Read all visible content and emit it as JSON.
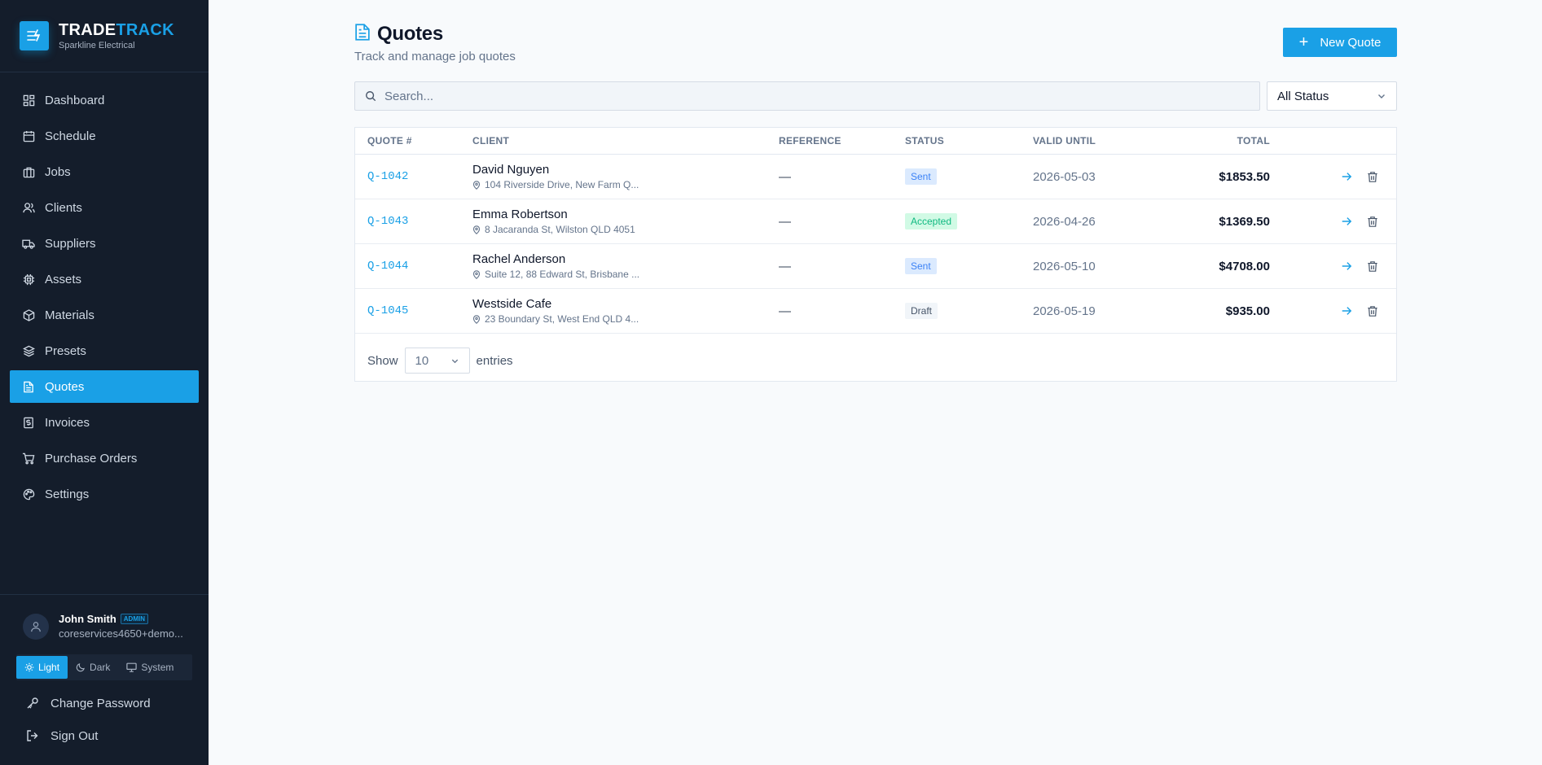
{
  "brand": {
    "name_part1": "TRADE",
    "name_part2": "TRACK",
    "company": "Sparkline Electrical",
    "logo_icon": "lightning-waves-icon"
  },
  "nav": [
    {
      "label": "Dashboard",
      "icon": "grid-icon"
    },
    {
      "label": "Schedule",
      "icon": "calendar-icon"
    },
    {
      "label": "Jobs",
      "icon": "briefcase-icon"
    },
    {
      "label": "Clients",
      "icon": "users-icon"
    },
    {
      "label": "Suppliers",
      "icon": "truck-icon"
    },
    {
      "label": "Assets",
      "icon": "chip-icon"
    },
    {
      "label": "Materials",
      "icon": "box-icon"
    },
    {
      "label": "Presets",
      "icon": "layers-icon"
    },
    {
      "label": "Quotes",
      "icon": "file-text-icon",
      "active": true
    },
    {
      "label": "Invoices",
      "icon": "dollar-file-icon"
    },
    {
      "label": "Purchase Orders",
      "icon": "cart-icon"
    },
    {
      "label": "Settings",
      "icon": "palette-icon"
    }
  ],
  "user": {
    "name": "John Smith",
    "role": "ADMIN",
    "email": "coreservices4650+demo..."
  },
  "theme": {
    "light": "Light",
    "dark": "Dark",
    "system": "System",
    "selected": "Light"
  },
  "account": {
    "change_password": "Change Password",
    "sign_out": "Sign Out"
  },
  "page": {
    "title": "Quotes",
    "subtitle": "Track and manage job quotes",
    "new_button": "New Quote"
  },
  "filters": {
    "search_placeholder": "Search...",
    "search_value": "",
    "status_selected": "All Status"
  },
  "table": {
    "columns": [
      "QUOTE #",
      "CLIENT",
      "REFERENCE",
      "STATUS",
      "VALID UNTIL",
      "TOTAL"
    ],
    "rows": [
      {
        "quote": "Q-1042",
        "client": "David Nguyen",
        "address": "104 Riverside Drive, New Farm Q...",
        "reference": "—",
        "status": "Sent",
        "valid_until": "2026-05-03",
        "total": "$1853.50"
      },
      {
        "quote": "Q-1043",
        "client": "Emma Robertson",
        "address": "8 Jacaranda St, Wilston QLD 4051",
        "reference": "—",
        "status": "Accepted",
        "valid_until": "2026-04-26",
        "total": "$1369.50"
      },
      {
        "quote": "Q-1044",
        "client": "Rachel Anderson",
        "address": "Suite 12, 88 Edward St, Brisbane ...",
        "reference": "—",
        "status": "Sent",
        "valid_until": "2026-05-10",
        "total": "$4708.00"
      },
      {
        "quote": "Q-1045",
        "client": "Westside Cafe",
        "address": "23 Boundary St, West End QLD 4...",
        "reference": "—",
        "status": "Draft",
        "valid_until": "2026-05-19",
        "total": "$935.00"
      }
    ]
  },
  "pagination": {
    "show_label": "Show",
    "page_size": "10",
    "entries_label": "entries"
  },
  "colors": {
    "accent": "#1aa0e6",
    "sidebar_bg": "#141d2b",
    "sent": "#3b82f6",
    "accepted": "#10b981",
    "draft": "#475569"
  }
}
